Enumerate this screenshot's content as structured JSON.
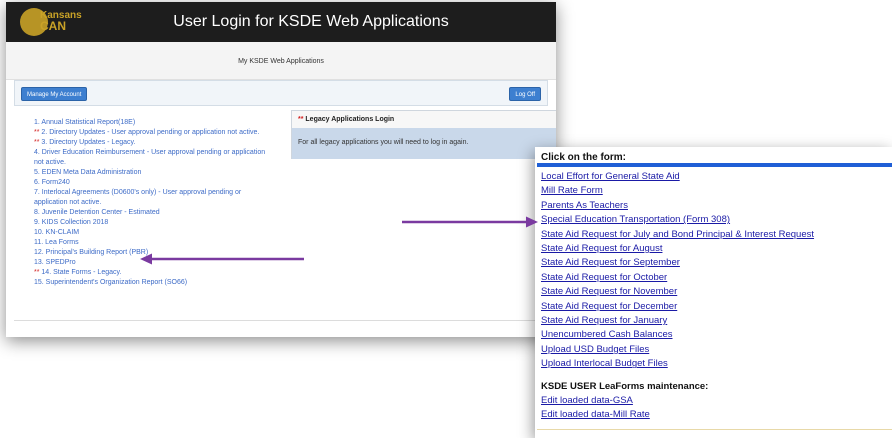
{
  "login_window": {
    "logo": {
      "line1": "Kansans",
      "line2": "CAN"
    },
    "title": "User Login for KSDE Web Applications",
    "subtitle": "My KSDE Web Applications",
    "manage_button": "Manage My Account",
    "logoff_button": "Log Off",
    "apps": [
      {
        "marker": "",
        "label": "1. Annual Statistical Report(18E)"
      },
      {
        "marker": "** ",
        "label": "2. Directory Updates - User approval pending or application not active."
      },
      {
        "marker": "** ",
        "label": "3. Directory Updates - Legacy."
      },
      {
        "marker": "",
        "label": "4. Driver Education Reimbursement - User approval pending or application not active."
      },
      {
        "marker": "",
        "label": "5. EDEN Meta Data Administration"
      },
      {
        "marker": "",
        "label": "6. Form240"
      },
      {
        "marker": "",
        "label": "7. Interlocal Agreements (D0600's only) - User approval pending or application not active."
      },
      {
        "marker": "",
        "label": "8. Juvenile Detention Center - Estimated"
      },
      {
        "marker": "",
        "label": "9. KIDS Collection 2018"
      },
      {
        "marker": "",
        "label": "10. KN-CLAIM"
      },
      {
        "marker": "",
        "label": "11. Lea Forms"
      },
      {
        "marker": "",
        "label": "12. Principal's Building Report (PBR)"
      },
      {
        "marker": "",
        "label": "13. SPEDPro"
      },
      {
        "marker": "** ",
        "label": "14. State Forms - Legacy."
      },
      {
        "marker": "",
        "label": "15. Superintendent's Organization Report (SO66)"
      }
    ],
    "legacy": {
      "marker": "** ",
      "title": "Legacy Applications Login",
      "body": "For all legacy applications you will need to log in again."
    }
  },
  "forms_window": {
    "heading": "Click on the form:",
    "links": [
      "Local Effort for General State Aid",
      "Mill Rate Form",
      "Parents As Teachers",
      "Special Education Transportation (Form 308)",
      "State Aid Request for July and Bond Principal & Interest Request",
      "State Aid Request for August",
      "State Aid Request for September",
      "State Aid Request for October",
      "State Aid Request for November",
      "State Aid Request for December",
      "State Aid Request for January",
      "Unencumbered Cash Balances",
      "Upload USD Budget Files",
      "Upload Interlocal Budget Files"
    ],
    "maintenance_heading": "KSDE USER LeaForms maintenance:",
    "maintenance_links": [
      "Edit loaded data-GSA",
      "Edit loaded data-Mill Rate"
    ]
  },
  "colors": {
    "arrow": "#7a3aa0",
    "link_blue": "#3d6bc7",
    "form_link": "#1a1aa6",
    "required_marker": "#d32222"
  }
}
